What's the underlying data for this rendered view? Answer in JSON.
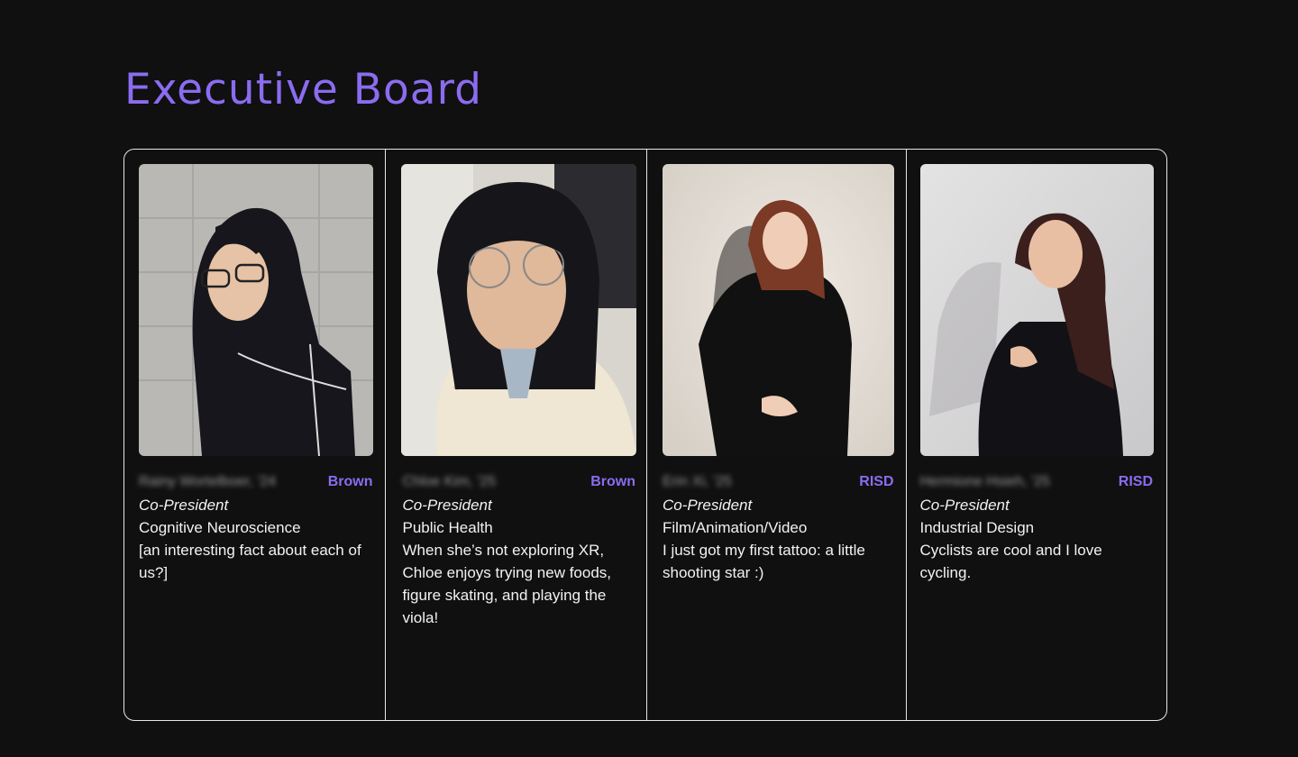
{
  "page": {
    "title": "Executive Board"
  },
  "colors": {
    "accent": "#8b6cf0",
    "background": "#101010",
    "text": "#f2f2f2",
    "border": "#e8e8e8"
  },
  "members": [
    {
      "name": "Rainy Wortelboer, '24",
      "school": "Brown",
      "role": "Co-President",
      "major": "Cognitive Neuroscience",
      "fact": "[an interesting fact about each of us?]",
      "photo_icon": "member-photo"
    },
    {
      "name": "Chloe Kim, '25",
      "school": "Brown",
      "role": "Co-President",
      "major": "Public Health",
      "fact": "When she’s not exploring XR, Chloe enjoys trying new foods, figure skating, and playing the viola!",
      "photo_icon": "member-photo"
    },
    {
      "name": "Erin Xi, '25",
      "school": "RISD",
      "role": "Co-President",
      "major": "Film/Animation/Video",
      "fact": "I just got my first tattoo: a little shooting star :)",
      "photo_icon": "member-photo"
    },
    {
      "name": "Hermione Hsieh, '25",
      "school": "RISD",
      "role": "Co-President",
      "major": "Industrial Design",
      "fact": "Cyclists are cool and I love cycling.",
      "photo_icon": "member-photo"
    }
  ]
}
